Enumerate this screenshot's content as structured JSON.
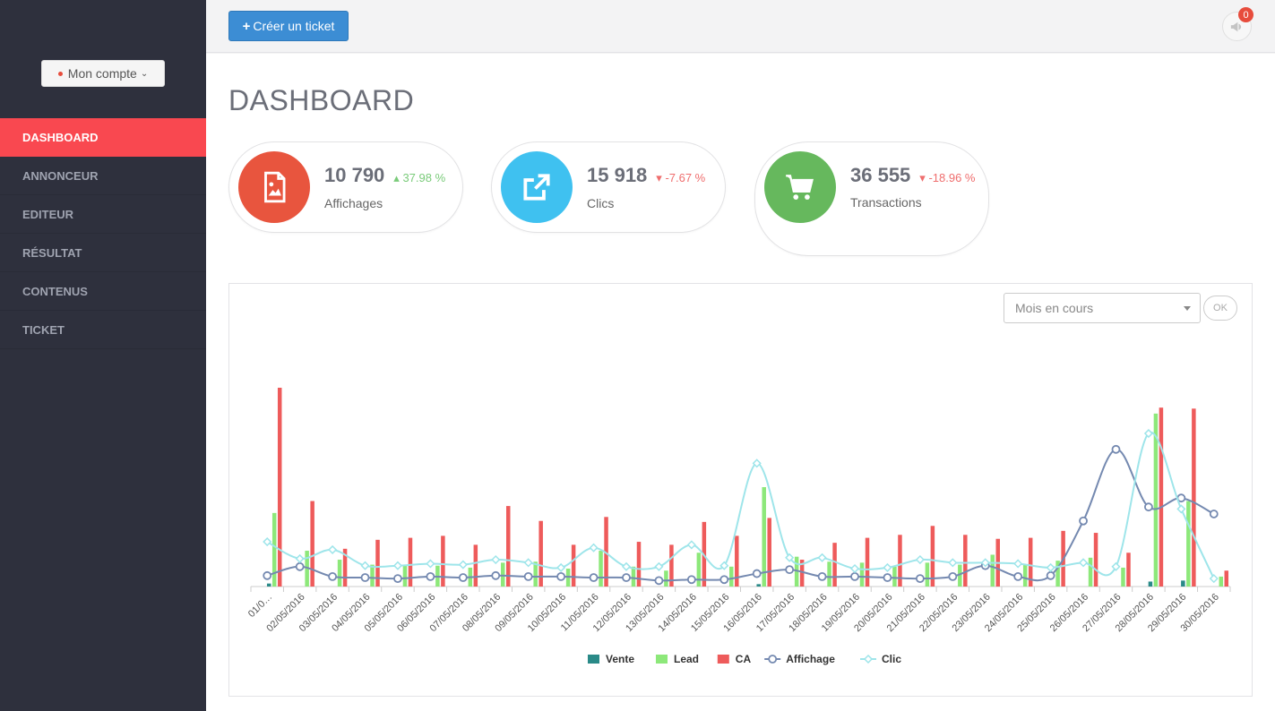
{
  "sidebar": {
    "account_label": "Mon compte",
    "items": [
      {
        "label": "DASHBOARD",
        "active": true
      },
      {
        "label": "ANNONCEUR",
        "active": false
      },
      {
        "label": "EDITEUR",
        "active": false
      },
      {
        "label": "RÉSULTAT",
        "active": false
      },
      {
        "label": "CONTENUS",
        "active": false
      },
      {
        "label": "TICKET",
        "active": false
      }
    ]
  },
  "topbar": {
    "create_ticket_label": "Créer un ticket",
    "notification_count": "0"
  },
  "page": {
    "title": "DASHBOARD"
  },
  "stats": [
    {
      "value": "10 790",
      "change": "37.98 %",
      "direction": "up",
      "label": "Affichages",
      "icon": "image-file-icon",
      "color": "#e8553e"
    },
    {
      "value": "15 918",
      "change": "-7.67 %",
      "direction": "down",
      "label": "Clics",
      "icon": "external-link-icon",
      "color": "#3fc1f0"
    },
    {
      "value": "36 555",
      "change": "-18.96 %",
      "direction": "down",
      "label": "Transactions",
      "icon": "shopping-cart-icon",
      "color": "#66b85d"
    }
  ],
  "filter": {
    "period_value": "Mois en cours",
    "ok_label": "OK"
  },
  "chart_data": {
    "type": "bar",
    "categories": [
      "01/05/2016",
      "02/05/2016",
      "03/05/2016",
      "04/05/2016",
      "05/05/2016",
      "06/05/2016",
      "07/05/2016",
      "08/05/2016",
      "09/05/2016",
      "10/05/2016",
      "11/05/2016",
      "12/05/2016",
      "13/05/2016",
      "14/05/2016",
      "15/05/2016",
      "16/05/2016",
      "17/05/2016",
      "18/05/2016",
      "19/05/2016",
      "20/05/2016",
      "21/05/2016",
      "22/05/2016",
      "23/05/2016",
      "24/05/2016",
      "25/05/2016",
      "26/05/2016",
      "27/05/2016",
      "28/05/2016",
      "29/05/2016",
      "30/05/2016"
    ],
    "first_tick_label": "01/0…",
    "ylim": [
      0,
      100
    ],
    "series": [
      {
        "name": "Vente",
        "type": "bar",
        "color": "#2a8a88",
        "values": [
          1.5,
          0,
          0,
          0,
          0,
          0,
          0,
          0,
          0,
          0,
          0,
          0,
          0,
          0,
          0,
          1.2,
          0,
          0,
          0,
          0,
          0,
          0,
          0,
          0,
          0,
          0,
          0,
          2.5,
          3,
          0
        ]
      },
      {
        "name": "Lead",
        "type": "bar",
        "color": "#8de87a",
        "values": [
          37,
          18,
          13.5,
          11,
          11,
          10.5,
          9.5,
          12,
          12.5,
          9,
          18,
          10,
          8,
          17,
          10,
          50,
          15,
          12.5,
          12,
          10,
          12,
          11,
          16,
          11,
          13,
          14.5,
          9.5,
          87,
          43,
          5
        ]
      },
      {
        "name": "CA",
        "type": "bar",
        "color": "#ee5b5b",
        "values": [
          100,
          43,
          19,
          23.5,
          24.5,
          25.5,
          21,
          40.5,
          33,
          21,
          35,
          22.5,
          21,
          32.5,
          25.5,
          34.5,
          13.5,
          22,
          24.5,
          26,
          30.5,
          26,
          24,
          24.5,
          28,
          27,
          17,
          90,
          89.5,
          8
        ]
      },
      {
        "name": "Affichage",
        "type": "line",
        "color": "#7489b0",
        "values": [
          5.5,
          10,
          5,
          4.5,
          4,
          5,
          4.5,
          5.5,
          5,
          5,
          4.5,
          4.5,
          3,
          3.5,
          3.5,
          6.5,
          8.5,
          5,
          5,
          4.5,
          4,
          5,
          10.5,
          5,
          5.5,
          33,
          69,
          40,
          44.5,
          36.5
        ]
      },
      {
        "name": "Clic",
        "type": "line",
        "color": "#9ee5ea",
        "values": [
          22.5,
          14,
          18.5,
          10.5,
          10.5,
          11.5,
          11,
          13.5,
          12,
          9.5,
          19.5,
          10,
          10,
          21,
          10.5,
          62,
          14.5,
          14.5,
          9,
          9.5,
          13.5,
          12,
          12,
          11.5,
          9.5,
          12,
          10,
          77,
          39,
          4
        ]
      }
    ]
  }
}
